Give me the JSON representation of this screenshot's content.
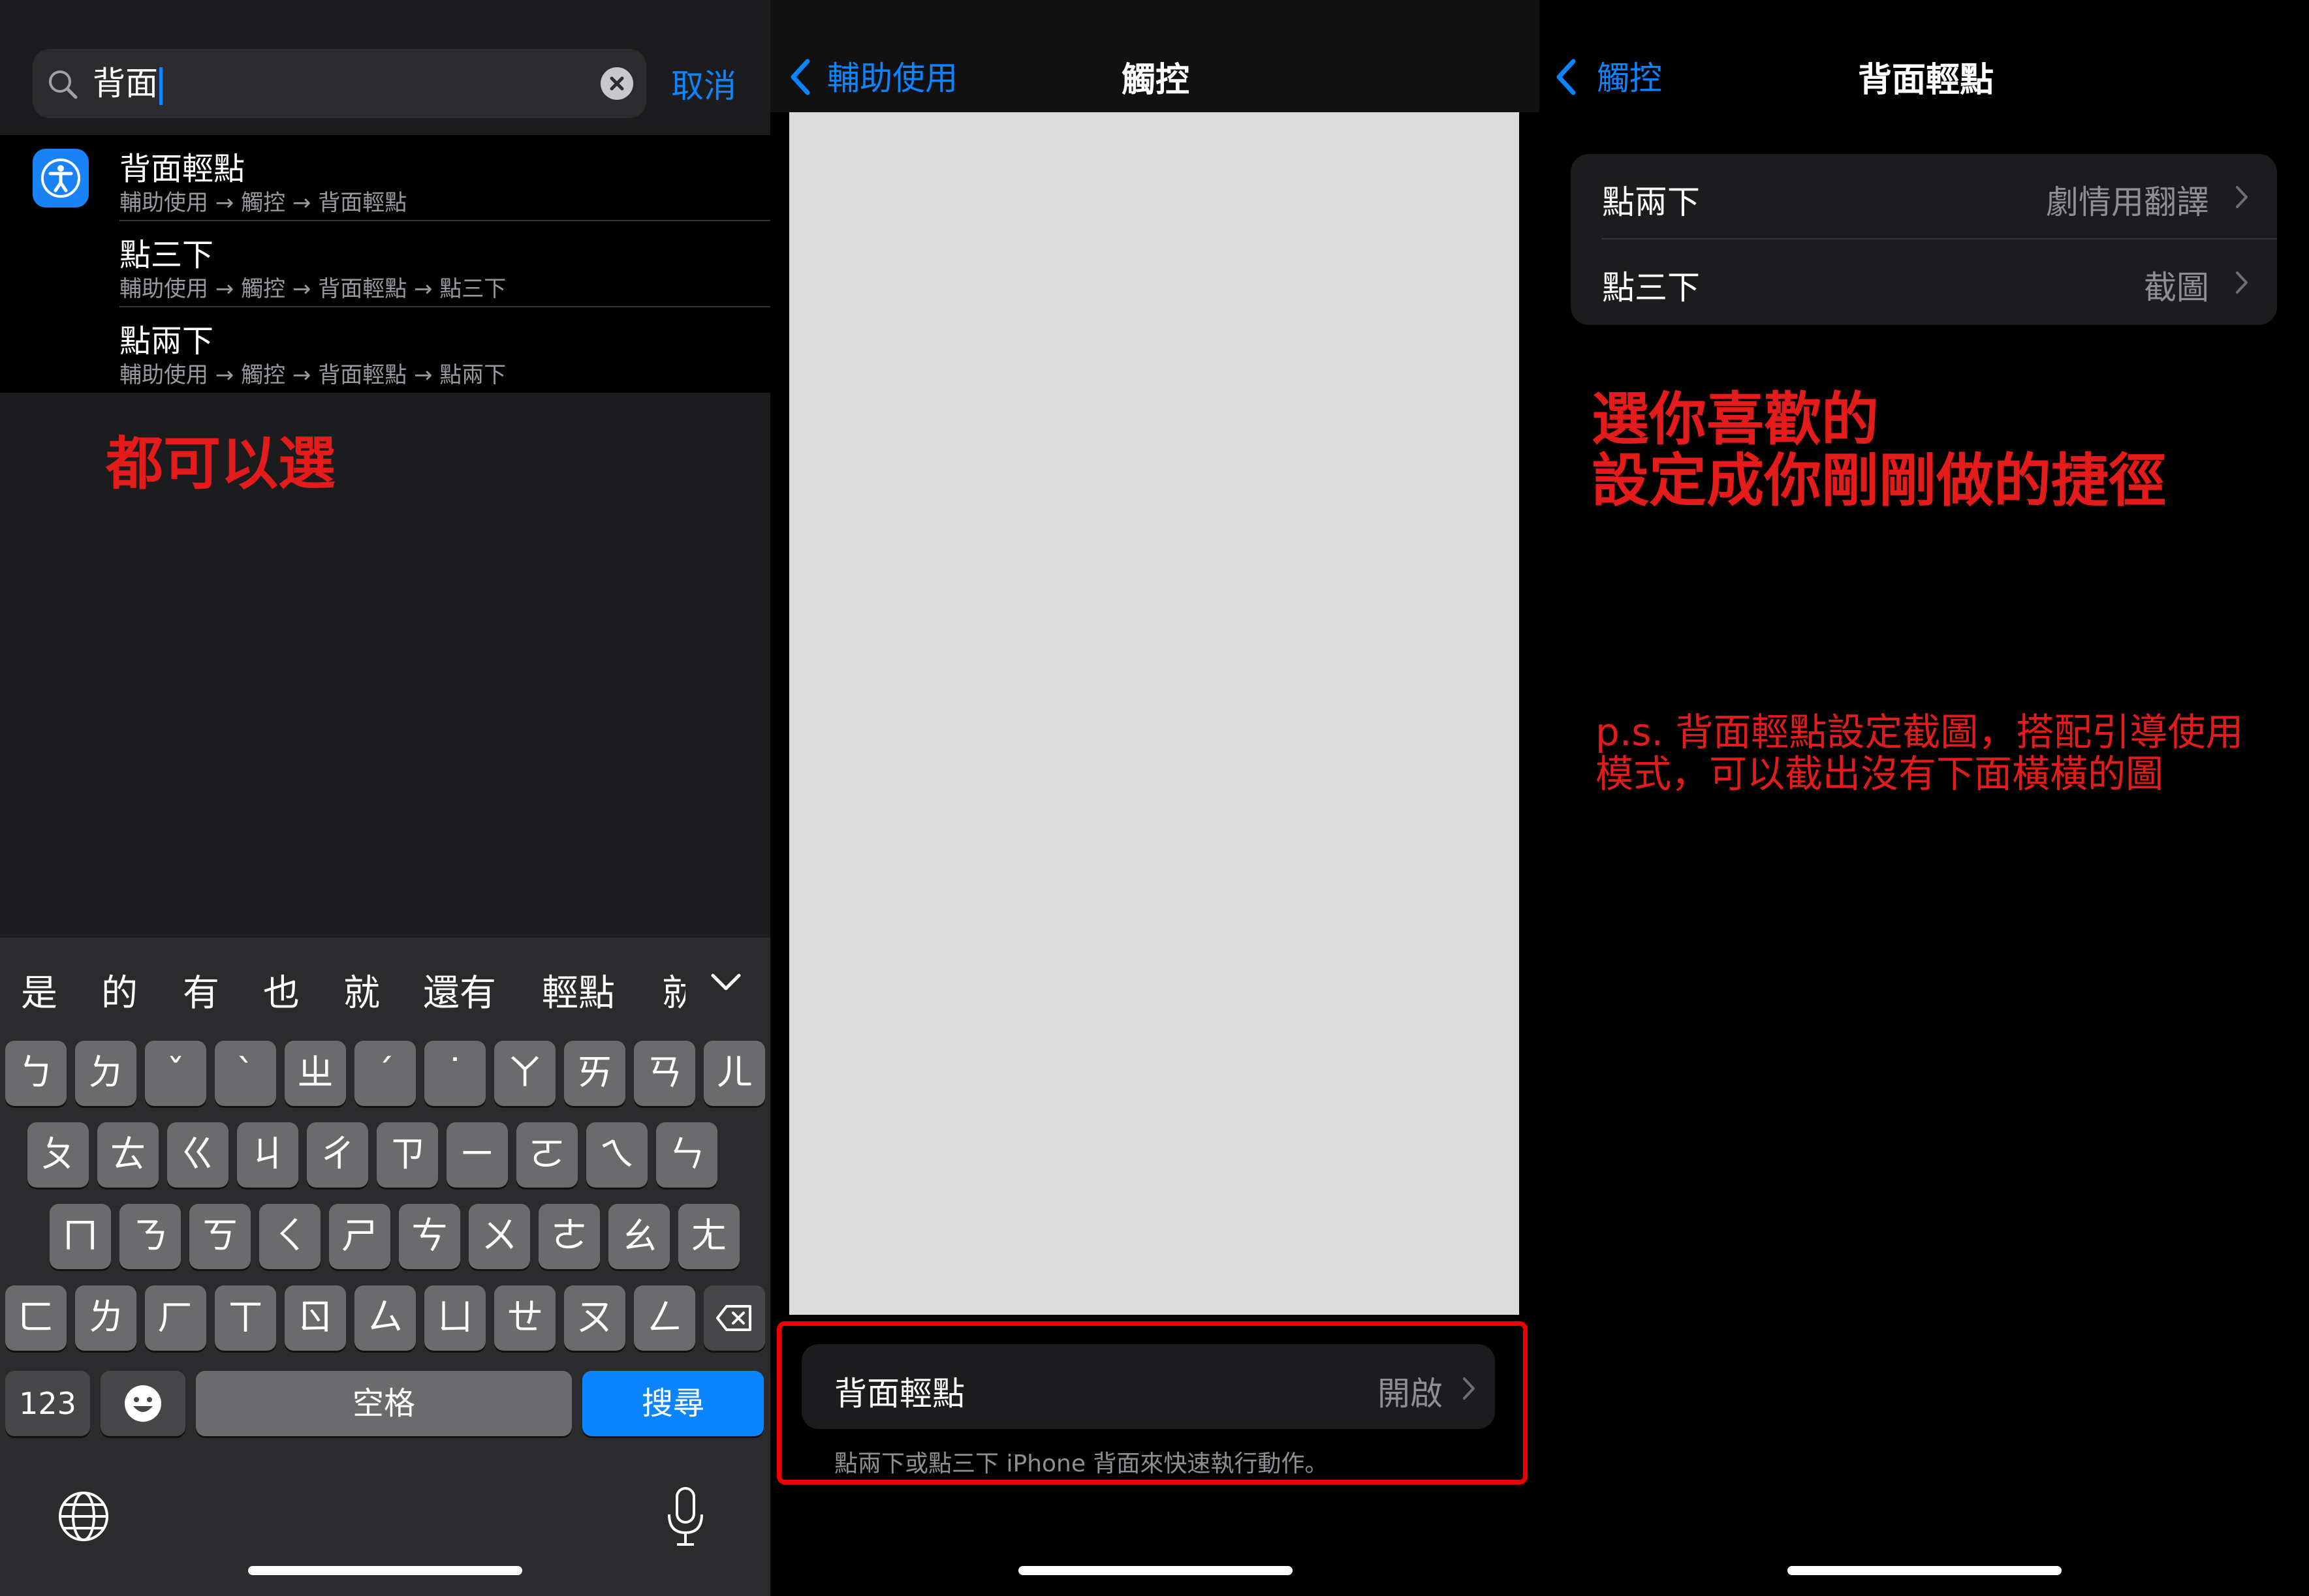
{
  "search_panel": {
    "query": "背面",
    "cancel_label": "取消",
    "results": [
      {
        "title": "背面輕點",
        "path": "輔助使用 → 觸控 → 背面輕點"
      },
      {
        "title": "點三下",
        "path": "輔助使用 → 觸控 → 背面輕點 → 點三下"
      },
      {
        "title": "點兩下",
        "path": "輔助使用 → 觸控 → 背面輕點 → 點兩下"
      }
    ],
    "annotation": "都可以選",
    "keyboard": {
      "candidates": [
        "是",
        "的",
        "有",
        "也",
        "就",
        "還有",
        "輕點",
        "就"
      ],
      "row1": [
        "ㄅ",
        "ㄉ",
        "ˇ",
        "ˋ",
        "ㄓ",
        "ˊ",
        "˙",
        "ㄚ",
        "ㄞ",
        "ㄢ",
        "ㄦ"
      ],
      "row2": [
        "ㄆ",
        "ㄊ",
        "ㄍ",
        "ㄐ",
        "ㄔ",
        "ㄗ",
        "ㄧ",
        "ㄛ",
        "ㄟ",
        "ㄣ"
      ],
      "row3": [
        "ㄇ",
        "ㄋ",
        "ㄎ",
        "ㄑ",
        "ㄕ",
        "ㄘ",
        "ㄨ",
        "ㄜ",
        "ㄠ",
        "ㄤ"
      ],
      "row4": [
        "ㄈ",
        "ㄌ",
        "ㄏ",
        "ㄒ",
        "ㄖ",
        "ㄙ",
        "ㄩ",
        "ㄝ",
        "ㄡ",
        "ㄥ"
      ],
      "numbers_label": "123",
      "space_label": "空格",
      "search_label": "搜尋"
    }
  },
  "touch_panel": {
    "back_label": "輔助使用",
    "title": "觸控",
    "back_tap_label": "背面輕點",
    "back_tap_value": "開啟",
    "footer": "點兩下或點三下 iPhone 背面來快速執行動作。"
  },
  "back_tap_panel": {
    "back_label": "觸控",
    "title": "背面輕點",
    "rows": [
      {
        "label": "點兩下",
        "value": "劇情用翻譯"
      },
      {
        "label": "點三下",
        "value": "截圖"
      }
    ],
    "annotation_main": [
      "選你喜歡的",
      "設定成你剛剛做的捷徑"
    ],
    "annotation_note": "p.s. 背面輕點設定截圖，搭配引導使用模式，可以截出沒有下面橫橫的圖"
  },
  "colors": {
    "accent": "#0a84ff",
    "annotation": "#e41b1b"
  }
}
